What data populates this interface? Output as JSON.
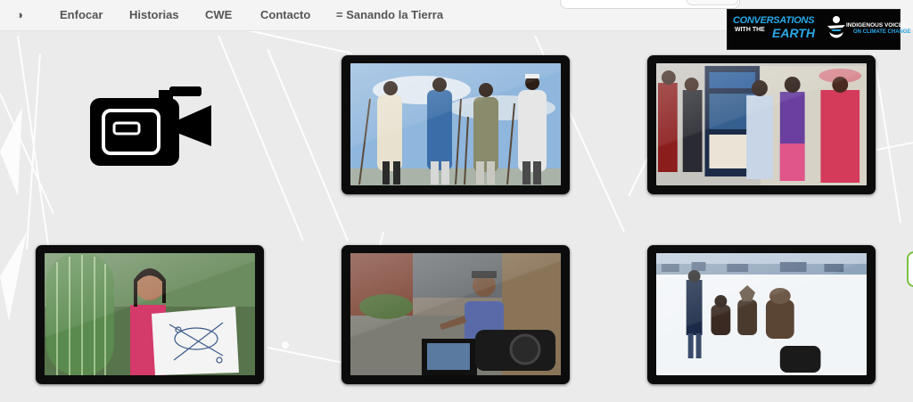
{
  "nav": {
    "toggle_icon": "◑",
    "items": [
      {
        "label": "Enfocar"
      },
      {
        "label": "Historias"
      },
      {
        "label": "CWE"
      },
      {
        "label": "Contacto"
      },
      {
        "label": "= Sanando la Tierra"
      }
    ]
  },
  "logo": {
    "line1": "CONVERSATIONS",
    "line2": "WITH THE",
    "line3": "EARTH",
    "line4": "INDIGENOUS VOICES",
    "line5": "ON CLIMATE CHANGE"
  },
  "gallery": {
    "camera_icon": "video-camera-icon",
    "tiles": [
      {
        "subject": "men-with-staffs"
      },
      {
        "subject": "women-at-exhibit"
      },
      {
        "subject": "woman-with-drawing-and-cactus"
      },
      {
        "subject": "man-being-filmed"
      },
      {
        "subject": "people-in-snow"
      }
    ]
  },
  "colors": {
    "accent": "#2aa8e8",
    "background": "#ebebeb",
    "frame": "#0c0c0c"
  }
}
